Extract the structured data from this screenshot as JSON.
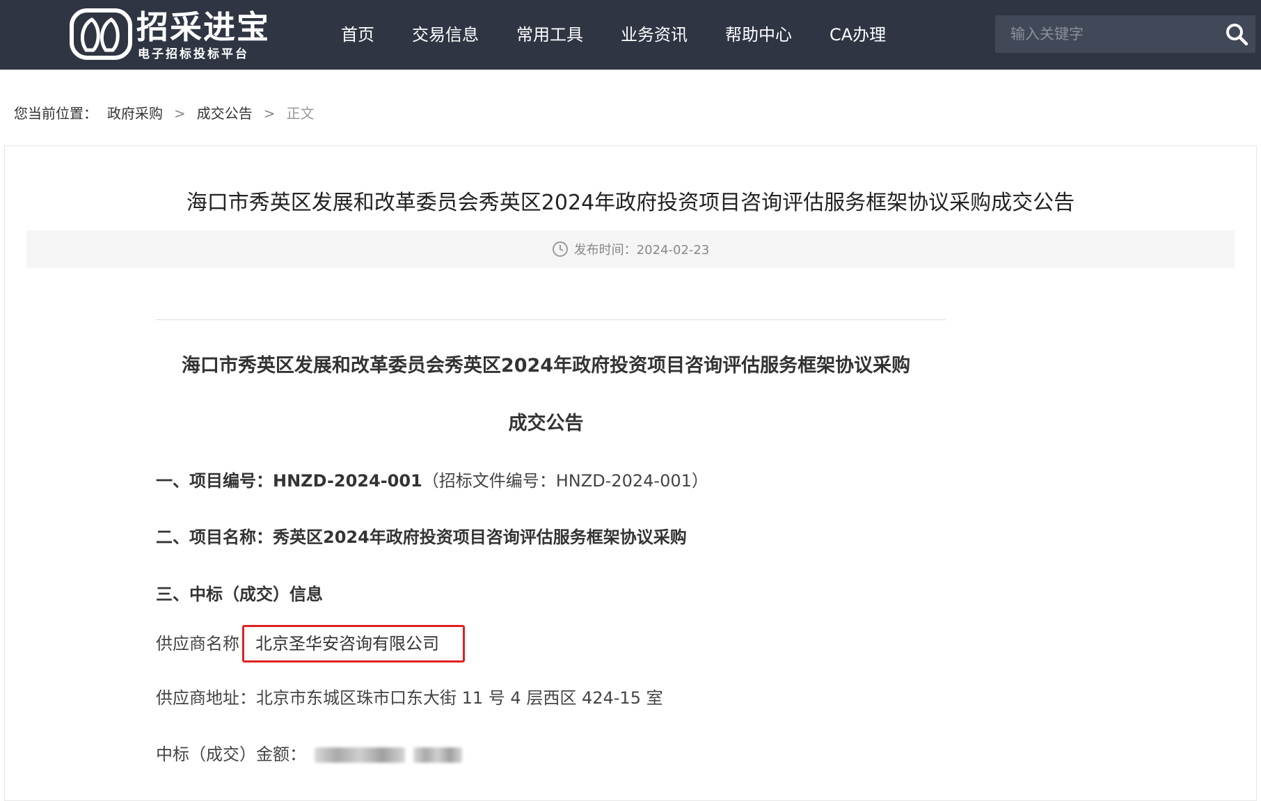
{
  "header": {
    "logo_title": "招采进宝",
    "logo_subtitle": "电子招标投标平台",
    "nav": [
      "首页",
      "交易信息",
      "常用工具",
      "业务资讯",
      "帮助中心",
      "CA办理"
    ],
    "search_placeholder": "输入关键字"
  },
  "breadcrumb": {
    "prefix": "您当前位置：",
    "items": [
      "政府采购",
      "成交公告"
    ],
    "current": "正文",
    "separator": ">"
  },
  "article": {
    "title": "海口市秀英区发展和改革委员会秀英区2024年政府投资项目咨询评估服务框架协议采购成交公告",
    "publish_label": "发布时间：2024-02-23",
    "doc_title_line1": "海口市秀英区发展和改革委员会秀英区2024年政府投资项目咨询评估服务框架协议采购",
    "doc_title_line2": "成交公告",
    "item1_label": "一、项目编号：",
    "item1_value": "HNZD-2024-001",
    "item1_extra": "（招标文件编号：HNZD-2024-001）",
    "item2_label": "二、项目名称：",
    "item2_value": "秀英区2024年政府投资项目咨询评估服务框架协议采购",
    "item3_label": "三、中标（成交）信息",
    "supplier_name_label": "供应商名称",
    "supplier_name_value": "北京圣华安咨询有限公司",
    "supplier_addr_label": "供应商地址：",
    "supplier_addr_value": "北京市东城区珠市口东大街 11 号 4 层西区 424-15 室",
    "amount_label": "中标（成交）金额："
  },
  "colors": {
    "header_bg": "#2f3543",
    "highlight_border": "#e02020"
  }
}
